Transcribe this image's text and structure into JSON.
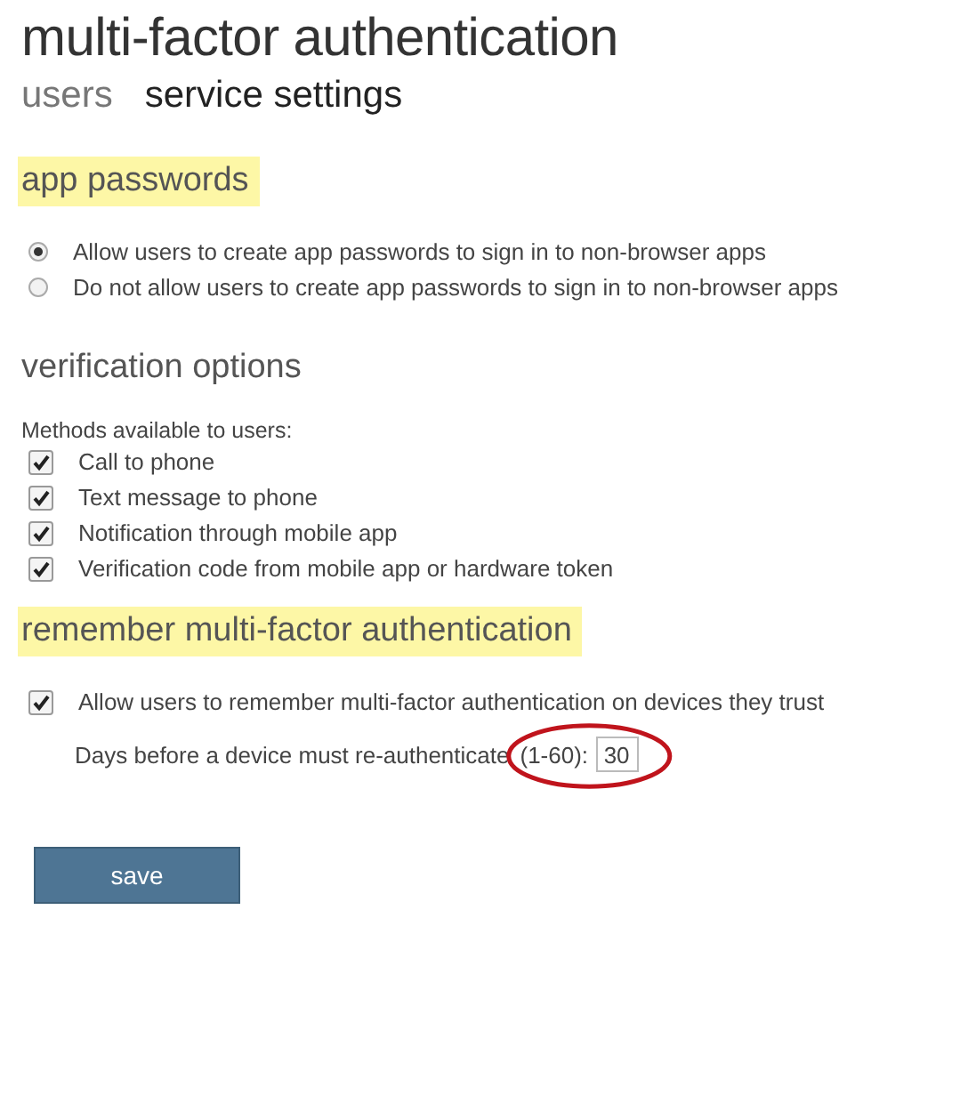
{
  "page": {
    "title": "multi-factor authentication"
  },
  "tabs": [
    {
      "label": "users",
      "selected": false
    },
    {
      "label": "service settings",
      "selected": true
    }
  ],
  "app_passwords": {
    "heading": "app passwords",
    "highlighted": true,
    "options": [
      {
        "label": "Allow users to create app passwords to sign in to non-browser apps",
        "selected": true
      },
      {
        "label": "Do not allow users to create app passwords to sign in to non-browser apps",
        "selected": false
      }
    ]
  },
  "verification_options": {
    "heading": "verification options",
    "highlighted": false,
    "intro": "Methods available to users:",
    "methods": [
      {
        "label": "Call to phone",
        "checked": true
      },
      {
        "label": "Text message to phone",
        "checked": true
      },
      {
        "label": "Notification through mobile app",
        "checked": true
      },
      {
        "label": "Verification code from mobile app or hardware token",
        "checked": true
      }
    ]
  },
  "remember_mfa": {
    "heading": "remember multi-factor authentication",
    "highlighted": true,
    "allow": {
      "label": "Allow users to remember multi-factor authentication on devices they trust",
      "checked": true
    },
    "days": {
      "label": "Days before a device must re-authenticate",
      "range": "(1-60):",
      "value": "30",
      "circled": true
    }
  },
  "buttons": [
    {
      "label": "save"
    }
  ]
}
